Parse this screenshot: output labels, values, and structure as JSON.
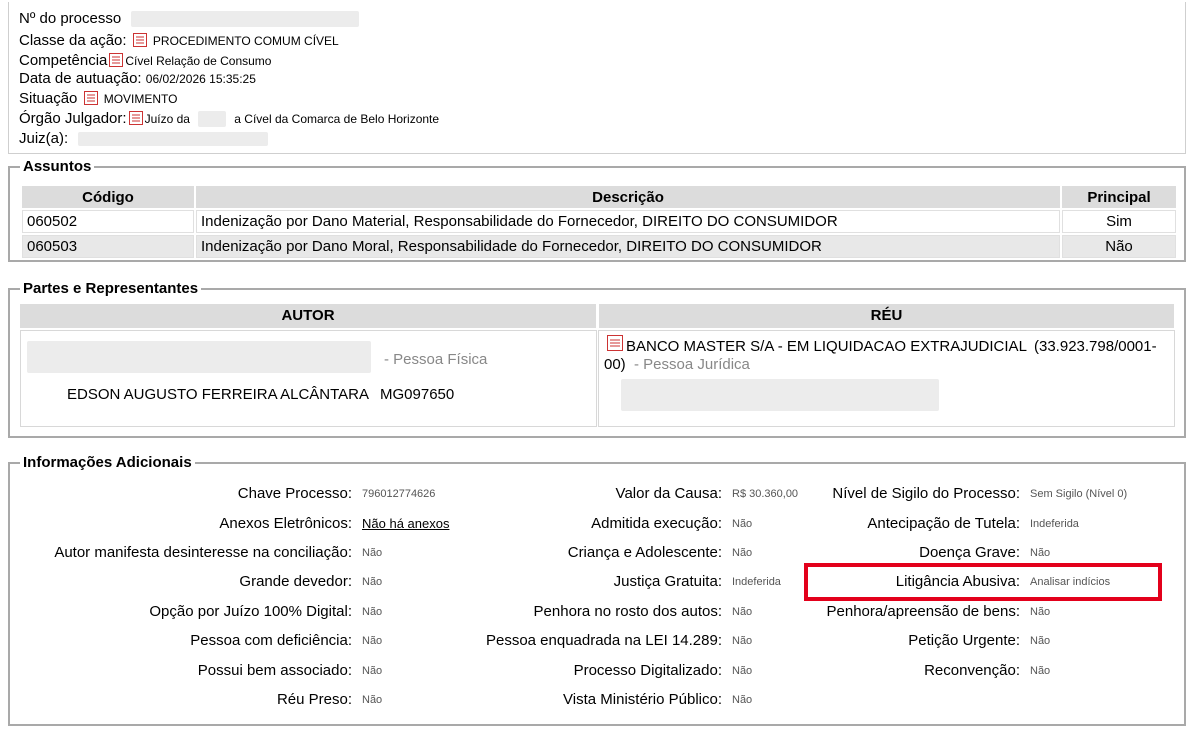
{
  "header": {
    "numero_label": "Nº do processo",
    "classe_label": "Classe da ação:",
    "classe_value": "PROCEDIMENTO COMUM CÍVEL",
    "competencia_label": "Competência",
    "competencia_value": "Cível Relação de Consumo",
    "data_label": "Data de autuação:",
    "data_value": "06/02/2026 15:35:25",
    "situacao_label": "Situação",
    "situacao_value": "MOVIMENTO",
    "orgao_label": "Órgão Julgador:",
    "orgao_value_a": "Juízo da",
    "orgao_value_b": "a Cível da Comarca de Belo Horizonte",
    "juiz_label": "Juiz(a):"
  },
  "assuntos": {
    "legend": "Assuntos",
    "columns": [
      "Código",
      "Descrição",
      "Principal"
    ],
    "rows": [
      {
        "codigo": "060502",
        "descricao": "Indenização por Dano Material, Responsabilidade do Fornecedor, DIREITO DO CONSUMIDOR",
        "principal": "Sim"
      },
      {
        "codigo": "060503",
        "descricao": "Indenização por Dano Moral, Responsabilidade do Fornecedor, DIREITO DO CONSUMIDOR",
        "principal": "Não"
      }
    ]
  },
  "partes": {
    "legend": "Partes e Representantes",
    "autor_header": "AUTOR",
    "reu_header": "RÉU",
    "autor_tipo": "- Pessoa Física",
    "autor_advogado": "EDSON AUGUSTO FERREIRA ALCÂNTARA",
    "autor_oab": "MG097650",
    "reu_nome": "BANCO MASTER S/A - EM LIQUIDACAO EXTRAJUDICIAL",
    "reu_cnpj_a": "(33.923.798/0001-",
    "reu_cnpj_b": "00)",
    "reu_tipo": "- Pessoa Jurídica"
  },
  "info": {
    "legend": "Informações Adicionais",
    "col1": [
      {
        "label": "Chave Processo:",
        "value": "796012774626"
      },
      {
        "label": "Anexos Eletrônicos:",
        "value": "Não há anexos"
      },
      {
        "label": "Autor manifesta desinteresse na conciliação:",
        "value": "Não"
      },
      {
        "label": "Grande devedor:",
        "value": "Não"
      },
      {
        "label": "Opção por Juízo 100% Digital:",
        "value": "Não"
      },
      {
        "label": "Pessoa com deficiência:",
        "value": "Não"
      },
      {
        "label": "Possui bem associado:",
        "value": "Não"
      },
      {
        "label": "Réu Preso:",
        "value": "Não"
      }
    ],
    "col2": [
      {
        "label": "Valor da Causa:",
        "value": "R$ 30.360,00"
      },
      {
        "label": "Admitida execução:",
        "value": "Não"
      },
      {
        "label": "Criança e Adolescente:",
        "value": "Não"
      },
      {
        "label": "Justiça Gratuita:",
        "value": "Indeferida"
      },
      {
        "label": "Penhora no rosto dos autos:",
        "value": "Não"
      },
      {
        "label": "Pessoa enquadrada na LEI 14.289:",
        "value": "Não"
      },
      {
        "label": "Processo Digitalizado:",
        "value": "Não"
      },
      {
        "label": "Vista Ministério Público:",
        "value": "Não"
      }
    ],
    "col3": [
      {
        "label": "Nível de Sigilo do Processo:",
        "value": "Sem Sigilo (Nível 0)"
      },
      {
        "label": "Antecipação de Tutela:",
        "value": "Indeferida"
      },
      {
        "label": "Doença Grave:",
        "value": "Não"
      },
      {
        "label": "Litigância Abusiva:",
        "value": "Analisar indícios"
      },
      {
        "label": "Penhora/apreensão de bens:",
        "value": "Não"
      },
      {
        "label": "Petição Urgente:",
        "value": "Não"
      },
      {
        "label": "Reconvenção:",
        "value": "Não"
      }
    ]
  },
  "colors": {
    "highlight": "#e3001b",
    "header_bg": "#dcdcdc"
  }
}
